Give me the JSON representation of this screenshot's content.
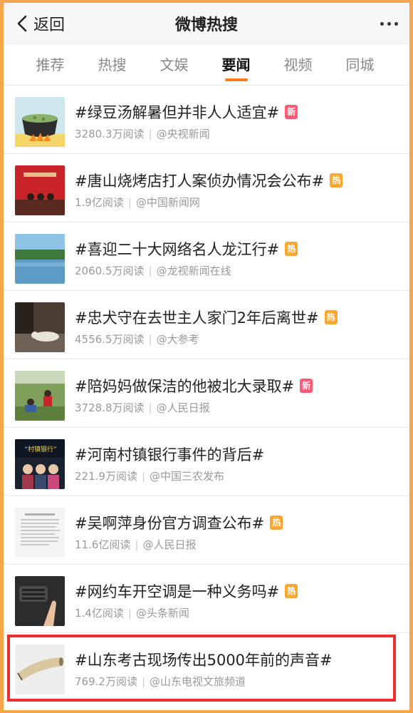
{
  "header": {
    "back_label": "返回",
    "title": "微博热搜"
  },
  "tabs": [
    "推荐",
    "热搜",
    "文娱",
    "要闻",
    "视频",
    "同城"
  ],
  "active_tab": "要闻",
  "items": [
    {
      "topic": "#绿豆汤解暑但并非人人适宜#",
      "badge": "新",
      "badge_type": "new",
      "reads": "3280.3万阅读",
      "source": "@央视新闻",
      "thumb": "pot-icon"
    },
    {
      "topic": "#唐山烧烤店打人案侦办情况会公布#",
      "badge": "热",
      "badge_type": "hot",
      "reads": "1.9亿阅读",
      "source": "@中国新闻网",
      "thumb": "press-conference-image"
    },
    {
      "topic": "#喜迎二十大网络名人龙江行#",
      "badge": "热",
      "badge_type": "hot",
      "reads": "2060.5万阅读",
      "source": "@龙视新闻在线",
      "thumb": "lake-landscape-image"
    },
    {
      "topic": "#忠犬守在去世主人家门2年后离世#",
      "badge": "热",
      "badge_type": "hot",
      "reads": "4556.5万阅读",
      "source": "@大参考",
      "thumb": "dog-image"
    },
    {
      "topic": "#陪妈妈做保洁的他被北大录取#",
      "badge": "新",
      "badge_type": "new",
      "reads": "3728.8万阅读",
      "source": "@人民日报",
      "thumb": "cleaning-image"
    },
    {
      "topic": "#河南村镇银行事件的背后#",
      "badge": "",
      "badge_type": "",
      "reads": "221.9万阅读",
      "source": "@中国三农发布",
      "thumb": "bank-news-image",
      "thumb_caption": "“村镇银行”"
    },
    {
      "topic": "#吴啊萍身份官方调查公布#",
      "badge": "热",
      "badge_type": "hot",
      "reads": "11.6亿阅读",
      "source": "@人民日报",
      "thumb": "document-image"
    },
    {
      "topic": "#网约车开空调是一种义务吗#",
      "badge": "热",
      "badge_type": "hot",
      "reads": "1.4亿阅读",
      "source": "@头条新闻",
      "thumb": "car-ac-image"
    },
    {
      "topic": "#山东考古现场传出5000年前的声音#",
      "badge": "",
      "badge_type": "",
      "reads": "769.2万阅读",
      "source": "@山东电视文旅频道",
      "thumb": "horn-artifact-image"
    }
  ],
  "colors": {
    "accent": "#ff7a1a",
    "new_badge": "#ff5b75",
    "hot_badge": "#ffa72c",
    "highlight": "#ee2d2d",
    "frame": "#f6a54a"
  }
}
